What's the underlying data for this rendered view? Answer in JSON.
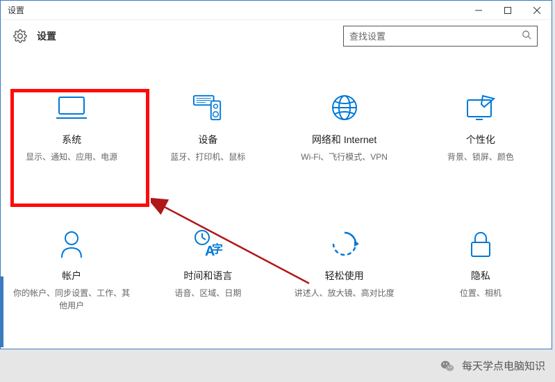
{
  "window": {
    "title": "设置"
  },
  "header": {
    "title": "设置"
  },
  "search": {
    "placeholder": "查找设置"
  },
  "tiles": [
    {
      "title": "系统",
      "desc": "显示、通知、应用、电源"
    },
    {
      "title": "设备",
      "desc": "蓝牙、打印机、鼠标"
    },
    {
      "title": "网络和 Internet",
      "desc": "Wi-Fi、飞行模式、VPN"
    },
    {
      "title": "个性化",
      "desc": "背景、锁屏、颜色"
    },
    {
      "title": "帐户",
      "desc": "你的帐户、同步设置、工作、其他用户"
    },
    {
      "title": "时间和语言",
      "desc": "语音、区域、日期"
    },
    {
      "title": "轻松使用",
      "desc": "讲述人、放大镜、高对比度"
    },
    {
      "title": "隐私",
      "desc": "位置、相机"
    }
  ],
  "footer": {
    "text": "每天学点电脑知识"
  }
}
